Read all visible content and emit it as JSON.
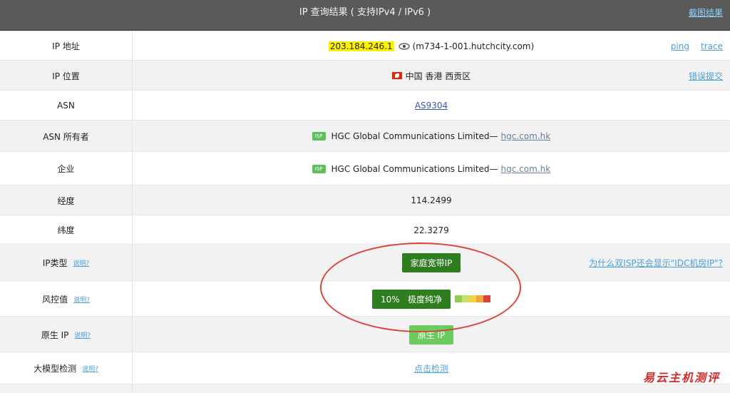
{
  "header": {
    "title": "IP 查询结果 ( 支持IPv4 / IPv6 )",
    "screenshot_link": "截图结果"
  },
  "rows": {
    "ip_address": {
      "label": "IP 地址",
      "ip": "203.184.246.1",
      "eye_icon": "eye-icon",
      "host": "(m734-1-001.hutchcity.com)",
      "ping": "ping",
      "trace": "trace"
    },
    "ip_location": {
      "label": "IP 位置",
      "flag_icon": "hong-kong-flag-icon",
      "location": "中国 香港 西贡区",
      "report_error": "错误提交"
    },
    "asn": {
      "label": "ASN",
      "value": "AS9304"
    },
    "asn_owner": {
      "label": "ASN 所有者",
      "isp_badge": "ISP",
      "name": "HGC Global Communications Limited—",
      "domain": "hgc.com.hk"
    },
    "enterprise": {
      "label": "企业",
      "isp_badge": "ISP",
      "name": "HGC Global Communications Limited—",
      "domain": "hgc.com.hk"
    },
    "longitude": {
      "label": "经度",
      "value": "114.2499"
    },
    "latitude": {
      "label": "纬度",
      "value": "22.3279"
    },
    "ip_type": {
      "label": "IP类型",
      "hint": "说明?",
      "value": "家庭宽带IP",
      "question": "为什么双ISP还会显示\"IDC机房IP\"?"
    },
    "risk": {
      "label": "风控值",
      "hint": "说明?",
      "value": "10%   极度纯净",
      "level_percent": 10,
      "bar_colors": [
        "#8fce4f",
        "#c7e06a",
        "#f2d24a",
        "#f0a53d",
        "#d9443b"
      ]
    },
    "native_ip": {
      "label": "原生 IP",
      "hint": "说明?",
      "value": "原生 IP"
    },
    "llm_check": {
      "label": "大模型检测",
      "hint": "说明?",
      "value": "点击检测"
    }
  },
  "watermark": "易云主机测评"
}
